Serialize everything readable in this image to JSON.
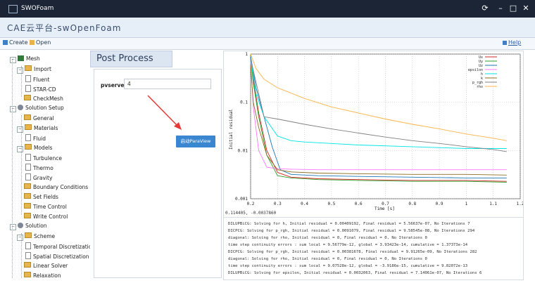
{
  "window": {
    "title": "SWOFoam"
  },
  "brand": {
    "title": "CAE云平台-swOpenFoam"
  },
  "toolbar": {
    "create_label": "Create",
    "open_label": "Open",
    "help_label": "Help"
  },
  "tree": {
    "mesh": "Mesh",
    "import": "Import",
    "fluent": "Fluent",
    "starcd": "STAR-CD",
    "checkmesh": "CheckMesh",
    "solution_setup": "Solution Setup",
    "general": "General",
    "materials": "Materials",
    "fluid": "Fluid",
    "models": "Models",
    "turbulence": "Turbulence",
    "thermo": "Thermo",
    "gravity": "Gravity",
    "boundary_conditions": "Boundary Conditions",
    "set_fields": "Set Fields",
    "time_control": "Time Control",
    "write_control": "Write Control",
    "solution": "Solution",
    "scheme": "Scheme",
    "temporal": "Temporal Discretization",
    "spatial": "Spatial Discretization",
    "linear_solver": "Linear Solver",
    "relaxation": "Relaxation"
  },
  "post": {
    "title": "Post Process",
    "pvserver_label": "pvserver:",
    "pvserver_value": "4",
    "launch_label": "启动ParaView"
  },
  "coord_readout": "0.114405, -0.0037860",
  "log": [
    "DILUPBiCG:  Solving for h, Initial residual = 0.00409192, Final residual = 5.56637e-07, No Iterations 7",
    "DICPCG:  Solving for p_rgh, Initial residual = 0.0091079, Final residual = 9.58545e-08, No Iterations 294",
    "diagonal:  Solving for rho, Initial residual = 0, Final residual = 0, No Iterations 0",
    "time step continuity errors : sum local = 9.56779e-12, global = 3.93423e-14, cumulative = 1.37373e-14",
    "DICPCG:  Solving for p_rgh, Initial residual = 0.00381678, Final residual = 9.91265e-09, No Iterations 282",
    "diagonal:  Solving for rho, Initial residual = 0, Final residual = 0, No Iterations 0",
    "time step continuity errors : sum local = 9.07528e-12, global = -3.9186e-15, cumulative = 9.82072e-13",
    "DILUPBiCG:  Solving for epsilon, Initial residual = 0.0032063, Final residual = 7.14061e-07, No Iterations 6"
  ],
  "chart_data": {
    "type": "line",
    "title": "",
    "xlabel": "Time [s]",
    "ylabel": "Initial residual",
    "xlim": [
      0.2,
      1.2
    ],
    "ylim": [
      0.001,
      1
    ],
    "yscale": "log",
    "x_ticks": [
      "0.2",
      "0.3",
      "0.4",
      "0.5",
      "0.6",
      "0.7",
      "0.8",
      "0.9",
      "1",
      "1.1",
      "1.2"
    ],
    "y_ticks": [
      "0.001",
      "0.01",
      "0.1",
      "1"
    ],
    "grid": true,
    "legend_position": "top-right",
    "series": [
      {
        "name": "Ux",
        "color": "#d62728",
        "x": [
          0.2,
          0.21,
          0.23,
          0.26,
          0.3,
          0.35,
          0.45,
          0.6,
          0.8,
          1.0,
          1.15
        ],
        "y": [
          0.9,
          0.3,
          0.06,
          0.01,
          0.0035,
          0.0028,
          0.0026,
          0.0025,
          0.0024,
          0.0024,
          0.0023
        ]
      },
      {
        "name": "Uy",
        "color": "#2ca02c",
        "x": [
          0.2,
          0.21,
          0.23,
          0.26,
          0.3,
          0.35,
          0.45,
          0.6,
          0.8,
          1.0,
          1.15
        ],
        "y": [
          0.9,
          0.25,
          0.05,
          0.008,
          0.003,
          0.0027,
          0.0025,
          0.0024,
          0.0023,
          0.0023,
          0.0022
        ]
      },
      {
        "name": "Uz",
        "color": "#1f77b4",
        "x": [
          0.2,
          0.22,
          0.25,
          0.28,
          0.31,
          0.35,
          0.45,
          0.6,
          0.8,
          1.0,
          1.15
        ],
        "y": [
          0.9,
          0.2,
          0.05,
          0.012,
          0.004,
          0.0032,
          0.003,
          0.0029,
          0.0028,
          0.0027,
          0.0027
        ]
      },
      {
        "name": "epsilon",
        "color": "#ff77ff",
        "x": [
          0.2,
          0.21,
          0.23,
          0.26,
          0.3,
          0.35,
          0.45,
          0.6,
          0.8,
          1.0,
          1.15
        ],
        "y": [
          0.7,
          0.08,
          0.01,
          0.0045,
          0.0042,
          0.0041,
          0.004,
          0.004,
          0.004,
          0.004,
          0.004
        ]
      },
      {
        "name": "h",
        "color": "#00e5e5",
        "x": [
          0.2,
          0.22,
          0.25,
          0.3,
          0.35,
          0.4,
          0.5,
          0.6,
          0.8,
          1.0,
          1.15
        ],
        "y": [
          0.8,
          0.15,
          0.05,
          0.02,
          0.016,
          0.015,
          0.014,
          0.013,
          0.012,
          0.011,
          0.011
        ]
      },
      {
        "name": "k",
        "color": "#8c6d1f",
        "x": [
          0.2,
          0.21,
          0.23,
          0.26,
          0.3,
          0.35,
          0.45,
          0.6,
          0.8,
          1.0,
          1.15
        ],
        "y": [
          0.6,
          0.1,
          0.03,
          0.008,
          0.004,
          0.0036,
          0.0034,
          0.0033,
          0.0032,
          0.0032,
          0.0031
        ]
      },
      {
        "name": "p_rgh",
        "color": "#808080",
        "x": [
          0.2,
          0.25,
          0.3,
          0.4,
          0.5,
          0.6,
          0.7,
          0.8,
          0.9,
          1.0,
          1.1,
          1.15
        ],
        "y": [
          0.8,
          0.05,
          0.045,
          0.035,
          0.028,
          0.023,
          0.019,
          0.016,
          0.014,
          0.012,
          0.0105,
          0.0095
        ]
      },
      {
        "name": "rho",
        "color": "#ffb347",
        "x": [
          0.2,
          0.22,
          0.25,
          0.3,
          0.4,
          0.5,
          0.6,
          0.7,
          0.8,
          0.9,
          1.0,
          1.1,
          1.15
        ],
        "y": [
          1.0,
          0.5,
          0.3,
          0.2,
          0.12,
          0.08,
          0.06,
          0.045,
          0.035,
          0.028,
          0.022,
          0.018,
          0.016
        ]
      }
    ]
  }
}
